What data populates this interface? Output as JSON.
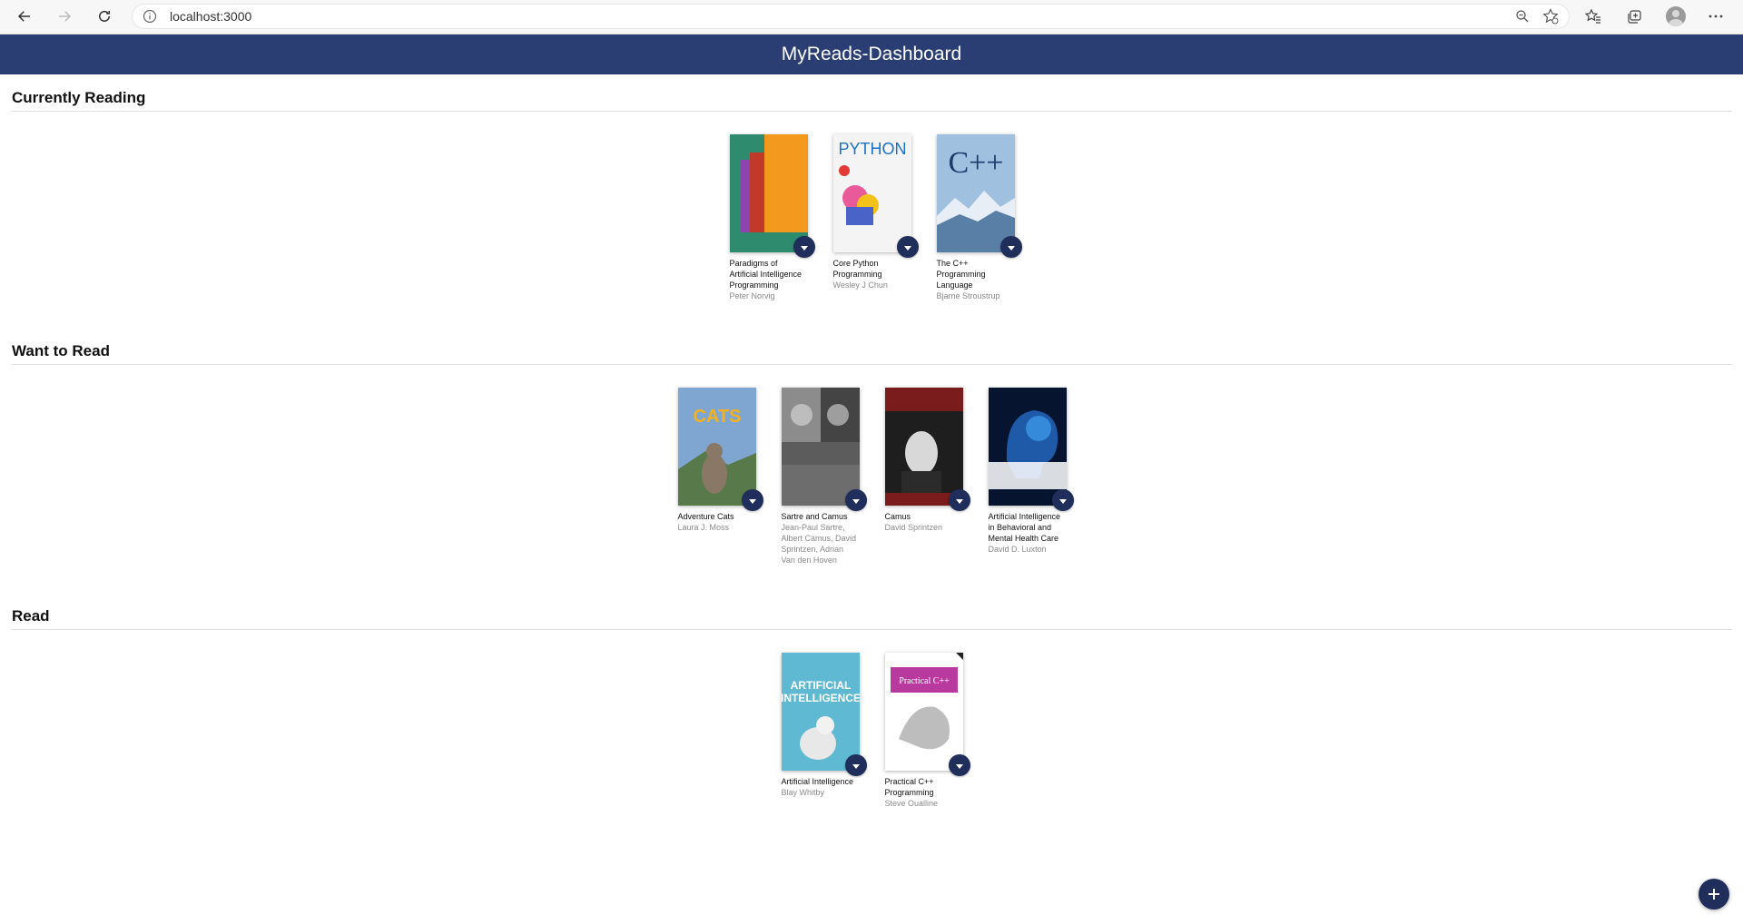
{
  "browser": {
    "url": "localhost:3000"
  },
  "app": {
    "title": "MyReads-Dashboard"
  },
  "shelves": [
    {
      "title": "Currently Reading",
      "books": [
        {
          "title": "Paradigms of Artificial Intelligence Programming",
          "authors": "Peter Norvig",
          "cover_color": "#2e8b6e"
        },
        {
          "title": "Core Python Programming",
          "authors": "Wesley J Chun",
          "cover_color": "#f2f2f2"
        },
        {
          "title": "The C++ Programming Language",
          "authors": "Bjarne Stroustrup",
          "cover_color": "#7ea3c9"
        }
      ]
    },
    {
      "title": "Want to Read",
      "books": [
        {
          "title": "Adventure Cats",
          "authors": "Laura J. Moss",
          "cover_color": "#6c8fbf"
        },
        {
          "title": "Sartre and Camus",
          "authors": "Jean-Paul Sartre, Albert Camus, David Sprintzen, Adrian Van den Hoven",
          "cover_color": "#5e5e5e"
        },
        {
          "title": "Camus",
          "authors": "David Sprintzen",
          "cover_color": "#2a2a2a"
        },
        {
          "title": "Artificial Intelligence in Behavioral and Mental Health Care",
          "authors": "David D. Luxton",
          "cover_color": "#0b1f45"
        }
      ]
    },
    {
      "title": "Read",
      "books": [
        {
          "title": "Artificial Intelligence",
          "authors": "Blay Whitby",
          "cover_color": "#5fb9d3"
        },
        {
          "title": "Practical C++ Programming",
          "authors": "Steve Oualline",
          "cover_color": "#ffffff"
        }
      ]
    }
  ]
}
